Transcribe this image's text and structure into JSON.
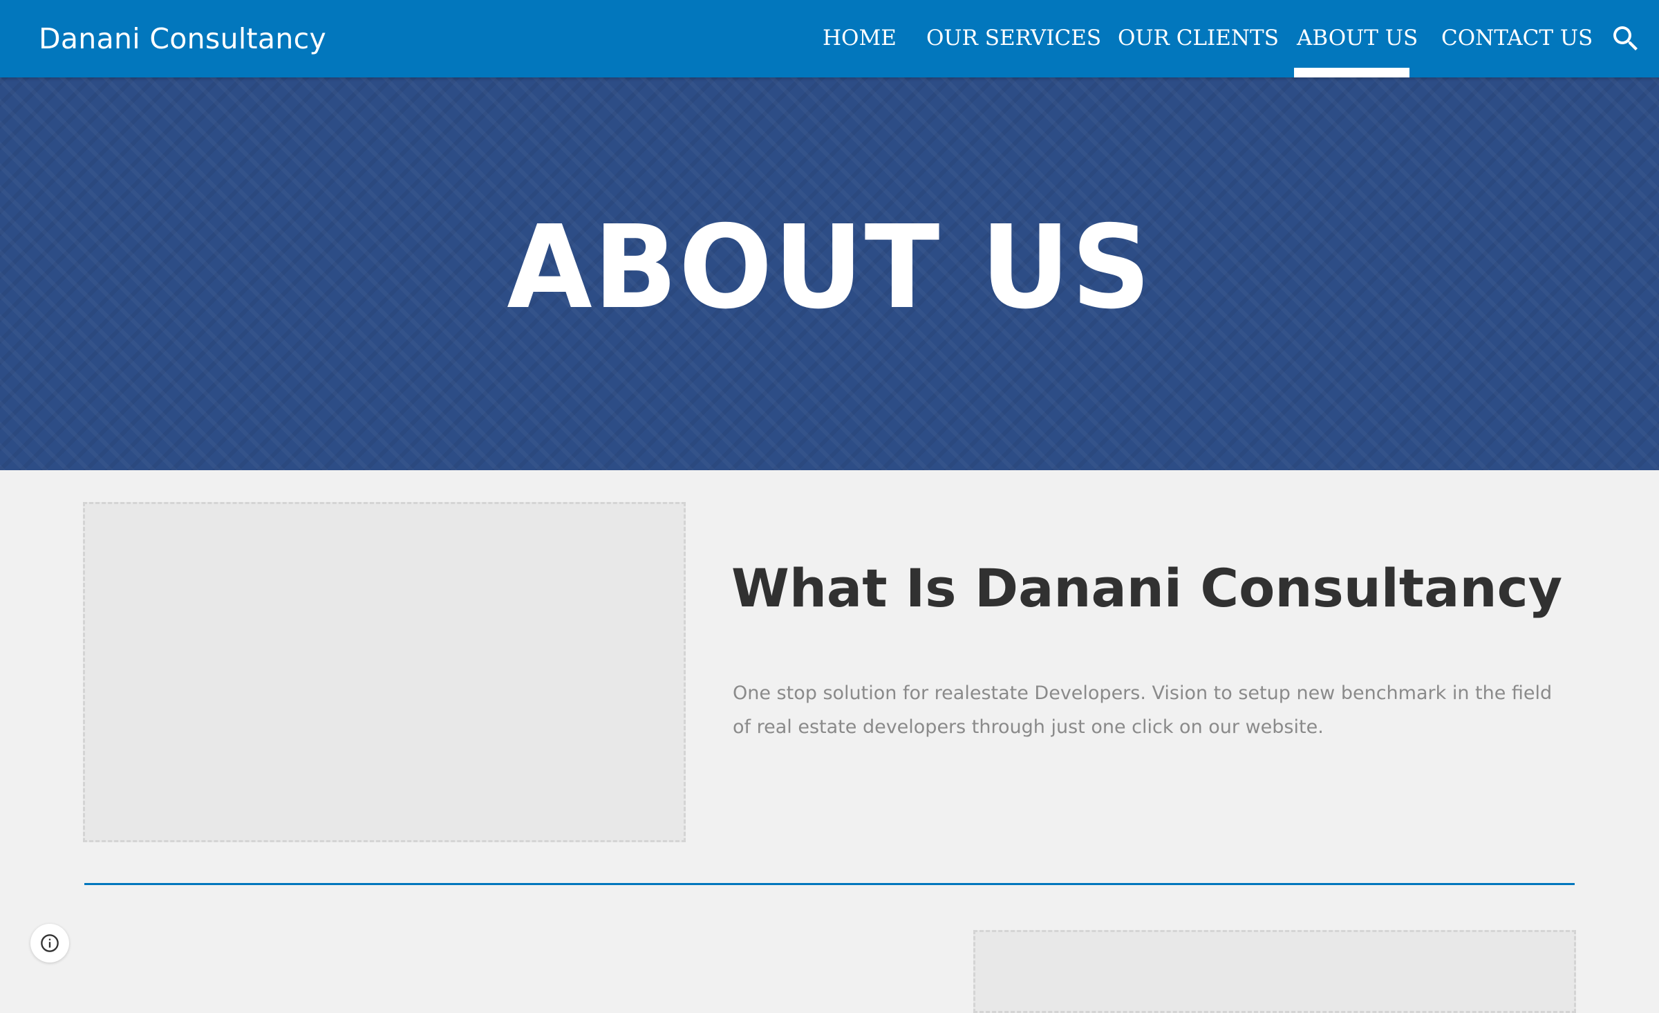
{
  "header": {
    "site_title": "Danani Consultancy",
    "nav": [
      {
        "label": "HOME"
      },
      {
        "label": "OUR SERVICES"
      },
      {
        "label": "OUR CLIENTS"
      },
      {
        "label": "ABOUT US",
        "active": true
      },
      {
        "label": "CONTACT US"
      }
    ],
    "search_icon": "search-icon"
  },
  "banner": {
    "title": "ABOUT US"
  },
  "about_section": {
    "heading": "What Is Danani Consultancy",
    "description": "One stop solution for realestate Developers. Vision to setup new benchmark in the field of real estate developers through just one click on our website."
  },
  "footer": {
    "info_icon": "info-icon"
  },
  "colors": {
    "header_bg": "#0277bd",
    "banner_bg": "#2d4d86",
    "divider": "#0277bd",
    "page_bg": "#f1f1f1"
  }
}
